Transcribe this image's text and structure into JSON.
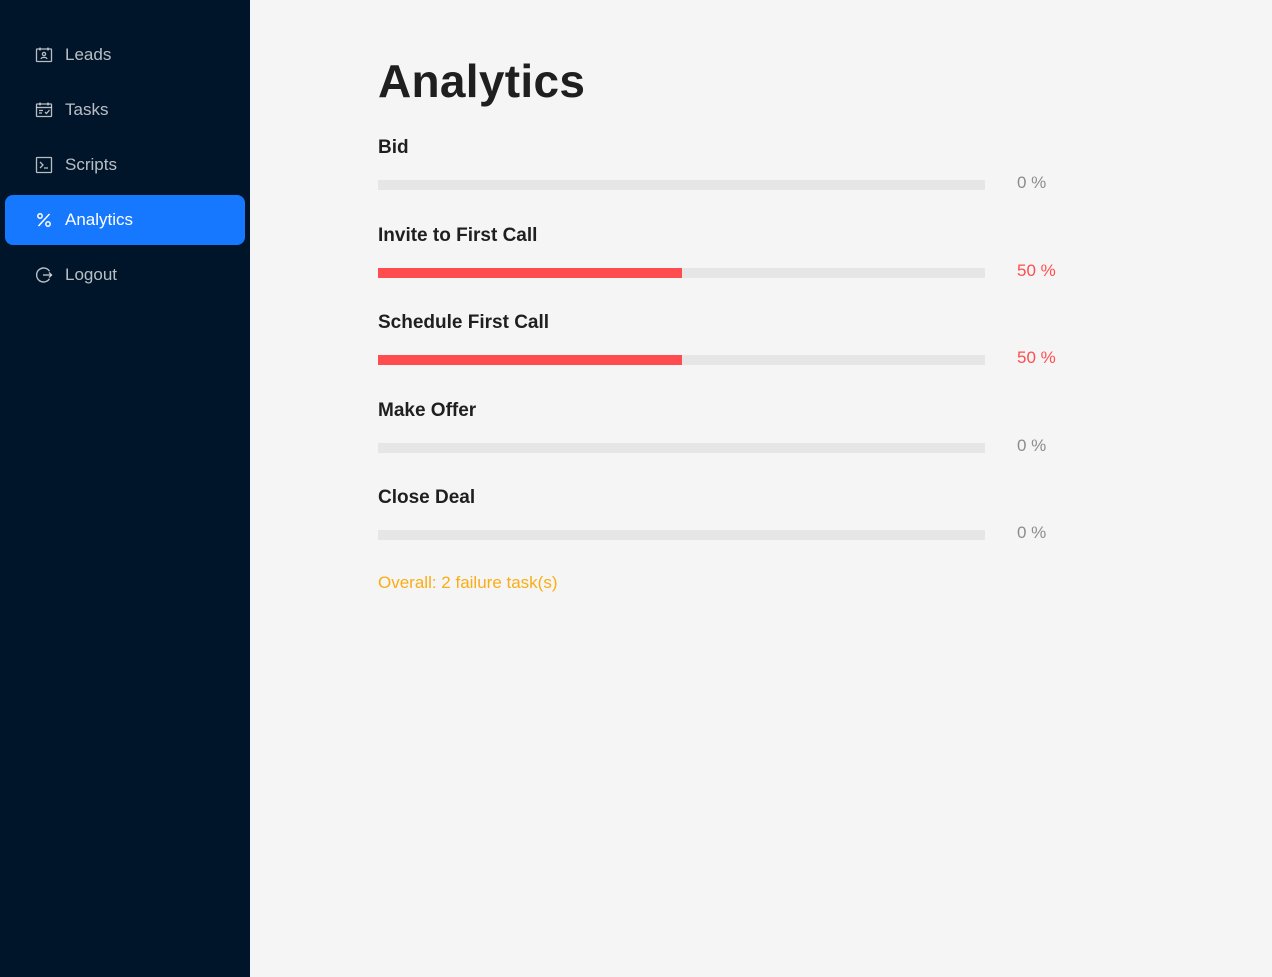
{
  "sidebar": {
    "items": [
      {
        "label": "Leads",
        "icon": "contacts-icon",
        "active": false
      },
      {
        "label": "Tasks",
        "icon": "schedule-icon",
        "active": false
      },
      {
        "label": "Scripts",
        "icon": "code-icon",
        "active": false
      },
      {
        "label": "Analytics",
        "icon": "percentage-icon",
        "active": true
      },
      {
        "label": "Logout",
        "icon": "logout-icon",
        "active": false
      }
    ]
  },
  "main": {
    "title": "Analytics",
    "stages": [
      {
        "label": "Bid",
        "percent": 0,
        "percent_text": "0 %",
        "status": "normal"
      },
      {
        "label": "Invite to First Call",
        "percent": 50,
        "percent_text": "50 %",
        "status": "exception"
      },
      {
        "label": "Schedule First Call",
        "percent": 50,
        "percent_text": "50 %",
        "status": "exception"
      },
      {
        "label": "Make Offer",
        "percent": 0,
        "percent_text": "0 %",
        "status": "normal"
      },
      {
        "label": "Close Deal",
        "percent": 0,
        "percent_text": "0 %",
        "status": "normal"
      }
    ],
    "overall": "Overall: 2 failure task(s)"
  },
  "colors": {
    "sidebar_bg": "#001529",
    "active_item": "#1677ff",
    "progress_fail": "#ff4d4f",
    "progress_track": "#e6e6e6",
    "overall_warning": "#faad14"
  }
}
